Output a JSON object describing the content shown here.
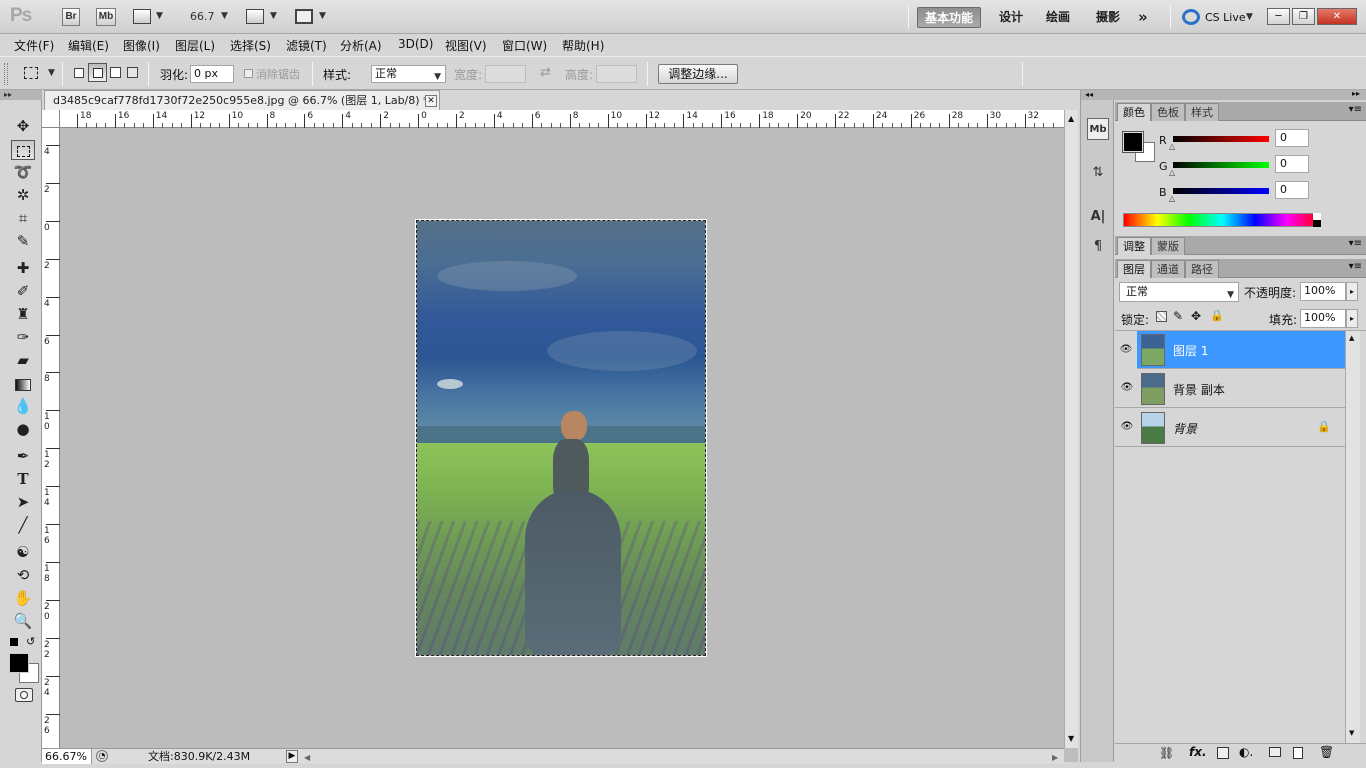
{
  "app": {
    "logo": "Ps",
    "bridge_label": "Br",
    "mini_bridge_label": "Mb",
    "zoom_value": "66.7",
    "workspaces": [
      "基本功能",
      "设计",
      "绘画",
      "摄影"
    ],
    "more_workspaces": "»",
    "cs_live": "CS Live",
    "window_buttons": {
      "minimize": "─",
      "restore": "❐",
      "close": "✕"
    }
  },
  "menu": [
    "文件(F)",
    "编辑(E)",
    "图像(I)",
    "图层(L)",
    "选择(S)",
    "滤镜(T)",
    "分析(A)",
    "3D(D)",
    "视图(V)",
    "窗口(W)",
    "帮助(H)"
  ],
  "options": {
    "feather_label": "羽化:",
    "feather_value": "0 px",
    "antialias_label": "消除锯齿",
    "style_label": "样式:",
    "style_value": "正常",
    "width_label": "宽度:",
    "height_label": "高度:",
    "refine_edge_button": "调整边缘..."
  },
  "document": {
    "tab_title": "d3485c9caf778fd1730f72e250c955e8.jpg @ 66.7% (图层 1, Lab/8) *",
    "h_ruler_labels": [
      "18",
      "16",
      "14",
      "12",
      "10",
      "8",
      "6",
      "4",
      "2",
      "0",
      "2",
      "4",
      "6",
      "8",
      "10",
      "12",
      "14",
      "16",
      "18",
      "20",
      "22",
      "24",
      "26",
      "28",
      "30",
      "32"
    ],
    "v_ruler_labels": [
      "4",
      "2",
      "0",
      "2",
      "4",
      "6",
      "8",
      "1 0",
      "1 2",
      "1 4",
      "1 6",
      "1 8",
      "2 0",
      "2 2",
      "2 4",
      "2 6"
    ],
    "zoom_status": "66.67%",
    "doc_size": "文档:830.9K/2.43M"
  },
  "color_panel": {
    "tabs": [
      "颜色",
      "色板",
      "样式"
    ],
    "channels": [
      {
        "label": "R",
        "value": "0"
      },
      {
        "label": "G",
        "value": "0"
      },
      {
        "label": "B",
        "value": "0"
      }
    ],
    "foreground": "#000000",
    "background": "#ffffff"
  },
  "adjust_panel": {
    "tabs": [
      "调整",
      "蒙版"
    ]
  },
  "layers_panel": {
    "tabs": [
      "图层",
      "通道",
      "路径"
    ],
    "blend_mode": "正常",
    "opacity_label": "不透明度:",
    "opacity_value": "100%",
    "lock_label": "锁定:",
    "fill_label": "填充:",
    "fill_value": "100%",
    "layers": [
      {
        "name": "图层 1",
        "selected": true
      },
      {
        "name": "背景 副本",
        "selected": false
      },
      {
        "name": "背景",
        "selected": false,
        "locked": true
      }
    ],
    "footer_icons": [
      "link-layers-icon",
      "fx-icon",
      "mask-icon",
      "adjustment-icon",
      "group-icon",
      "new-layer-icon",
      "trash-icon"
    ]
  },
  "colors": {
    "selected_layer": "#3c97ff",
    "accent_red": "#c43324"
  }
}
